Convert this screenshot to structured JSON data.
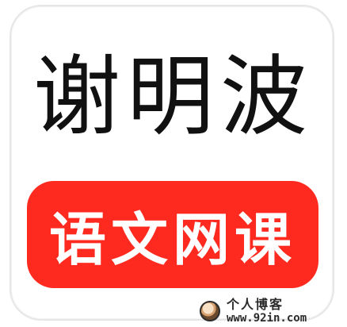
{
  "app": {
    "name": "谢明波",
    "subtitle": "语文网课"
  },
  "watermark": {
    "title": "个人博客",
    "url": "www.92in.com"
  },
  "colors": {
    "pill_bg": "#ff2a1f",
    "text_primary": "#111111",
    "text_on_pill": "#ffffff"
  },
  "icons": {
    "watermark_mascot": "watermark-mascot-icon"
  }
}
